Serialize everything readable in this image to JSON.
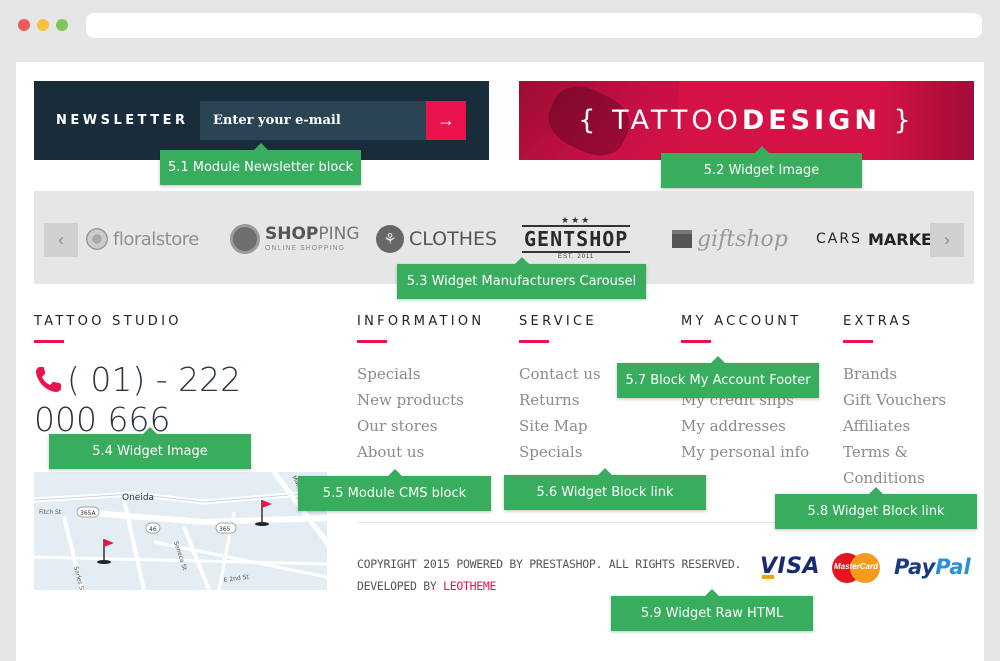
{
  "newsletter": {
    "title": "NEWSLETTER",
    "placeholder": "Enter your e-mail",
    "submit_icon": "arrow-right-icon"
  },
  "banner": {
    "text_open": "{ TATTOO",
    "text_bold": "DESIGN",
    "text_close": " }"
  },
  "carousel": {
    "prev_icon": "‹",
    "next_icon": "›",
    "brands": {
      "floral": "floralstore",
      "shopping_bold": "SHOP",
      "shopping_light": "PING",
      "shopping_sub": "ONLINE SHOPPING",
      "clothes": "CLOTHES",
      "gentshop_stars": "★★★",
      "gentshop": "GENTSHOP",
      "gentshop_est": "EST. 2011",
      "giftshop": "giftshop",
      "cars": "CARS",
      "market": "MARKET"
    }
  },
  "columns": {
    "studio": {
      "title": "TATTOO STUDIO",
      "phone": "( 01) - 222 000 666"
    },
    "information": {
      "title": "INFORMATION",
      "links": [
        "Specials",
        "New products",
        "Our stores",
        "About us"
      ]
    },
    "service": {
      "title": "SERVICE",
      "links": [
        "Contact us",
        "Returns",
        "Site Map",
        "Specials"
      ]
    },
    "account": {
      "title": "MY ACCOUNT",
      "links": [
        "My credit slips",
        "My addresses",
        "My personal info"
      ]
    },
    "extras": {
      "title": "EXTRAS",
      "links": [
        "Brands",
        "Gift Vouchers",
        "Affiliates",
        "Terms &",
        "Conditions"
      ]
    }
  },
  "map": {
    "labels": [
      "Oneida",
      "Fitch St",
      "365A",
      "46",
      "365",
      "Sarles St",
      "Seneca St",
      "E 2nd St",
      "Main St",
      "Oneida"
    ]
  },
  "copyright": {
    "line1": "COPYRIGHT 2015 POWERED BY PRESTASHOP. ALL RIGHTS RESERVED.",
    "line2_prefix": "DEVELOPED BY ",
    "line2_link": "LEOTHEME"
  },
  "payments": {
    "visa": "VISA",
    "mastercard": "MasterCard",
    "paypal_1": "Pay",
    "paypal_2": "Pal"
  },
  "annotations": {
    "a51": "5.1 Module Newsletter block",
    "a52": "5.2 Widget Image",
    "a53": "5.3 Widget Manufacturers Carousel",
    "a54": "5.4 Widget Image",
    "a55": "5.5 Module CMS block",
    "a56": "5.6 Widget Block link",
    "a57": "5.7 Block My Account Footer",
    "a58": "5.8 Widget Block link",
    "a59": "5.9 Widget Raw HTML"
  },
  "colors": {
    "accent": "#e8144b",
    "navy": "#182c3a",
    "annotation": "#38ad5e"
  }
}
